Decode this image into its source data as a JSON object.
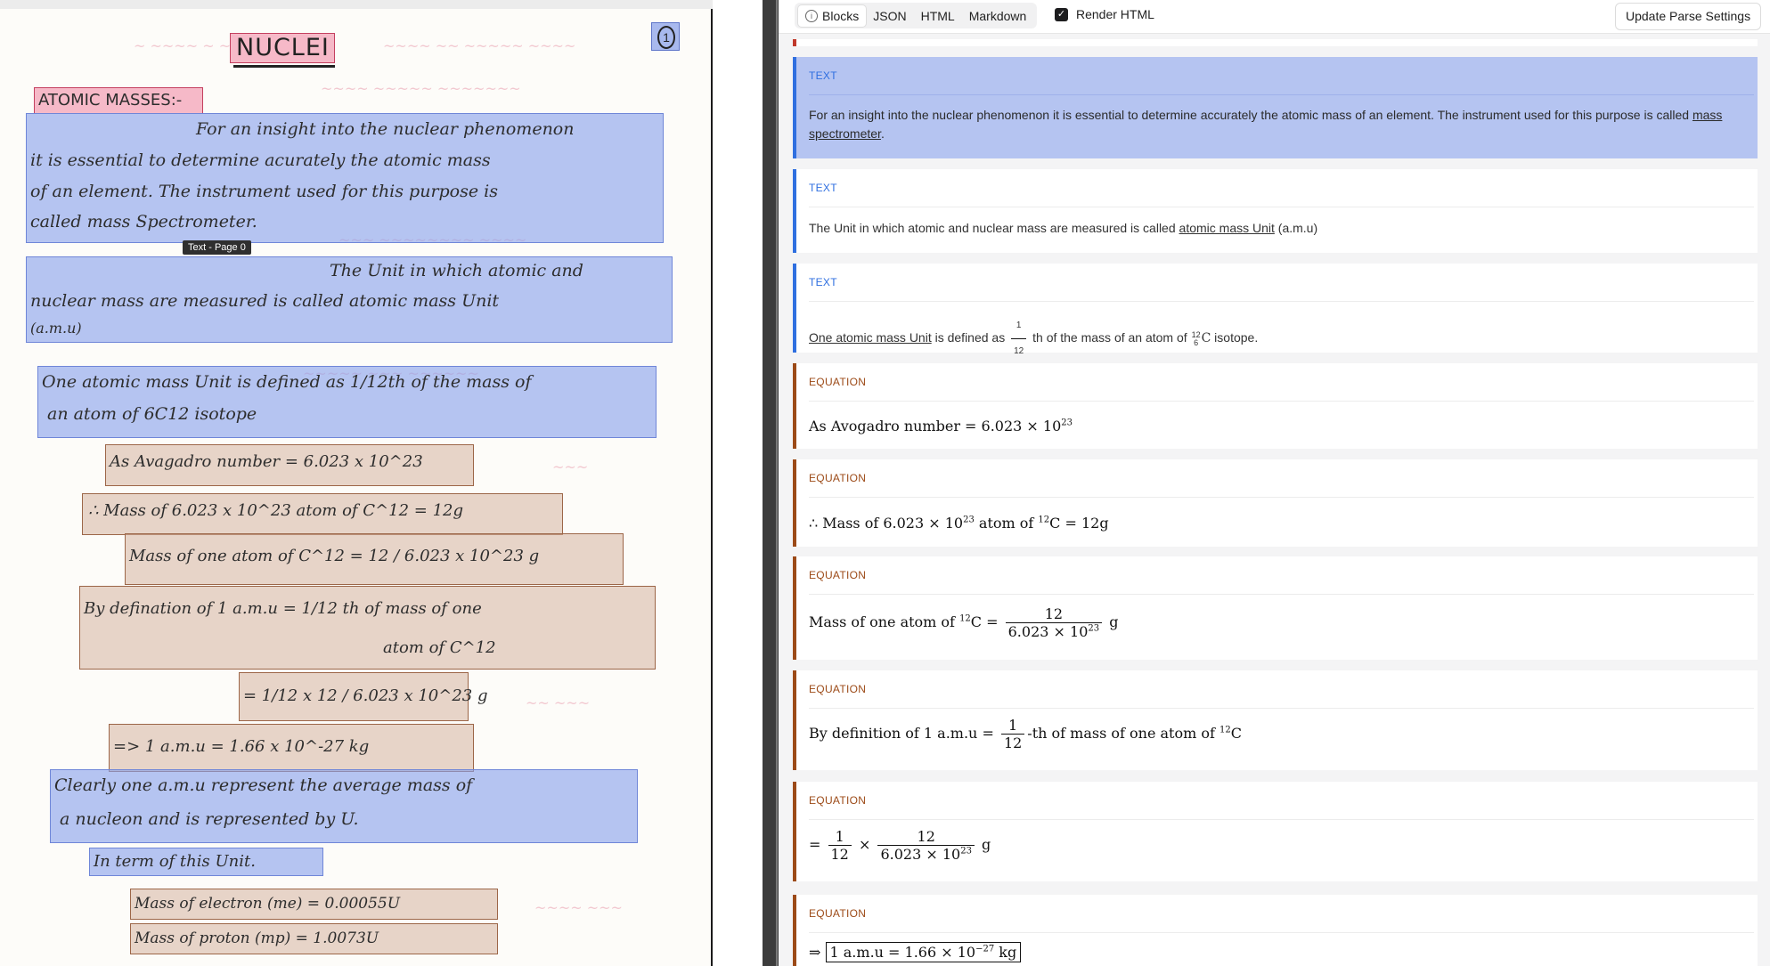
{
  "toolbar": {
    "tabs": [
      "Blocks",
      "JSON",
      "HTML",
      "Markdown"
    ],
    "active_tab": "Blocks",
    "render_html_label": "Render HTML",
    "render_html_checked": true,
    "update_button": "Update Parse Settings"
  },
  "page": {
    "title": "NUCLEI",
    "page_number": "1",
    "tooltip": "Text - Page 0",
    "lines": {
      "atomic_masses": "ATOMIC MASSES:-",
      "t1a": "For an insight into the nuclear phenomenon",
      "t1b": "it is essential to determine acurately the atomic mass",
      "t1c": "of an element. The instrument used for this purpose is",
      "t1d": "called mass Spectrometer.",
      "t2a": "The Unit in which atomic and",
      "t2b": "nuclear mass are measured is called atomic mass Unit",
      "t2c": "(a.m.u)",
      "t3a": "One atomic mass Unit is defined as 1/12th of the mass of",
      "t3b": "an atom of 6C12 isotope",
      "e1": "As Avagadro number = 6.023 x 10^23",
      "e2": "∴ Mass of 6.023 x 10^23 atom of C^12 = 12g",
      "e3": "Mass of one atom of C^12 = 12 / 6.023 x 10^23 g",
      "e4a": "By defination of 1 a.m.u = 1/12 th of mass of one",
      "e4b": "atom of C^12",
      "e5": "= 1/12 x 12 / 6.023 x 10^23 g",
      "e6": "=> 1 a.m.u = 1.66 x 10^-27 kg",
      "t4a": "Clearly one a.m.u represent the average mass of",
      "t4b": "a nucleon and is represented by U.",
      "t5": "In term of this Unit.",
      "e7": "Mass of electron (me) = 0.00055U",
      "e8": "Mass of proton (mp) = 1.0073U"
    }
  },
  "blocks": [
    {
      "type": "TEXT",
      "text_before": "For an insight into the nuclear phenomenon it is essential to determine accurately the atomic mass of an element. The instrument used for this purpose is called ",
      "link": "mass spectrometer",
      "text_after": "."
    },
    {
      "type": "TEXT",
      "text_before": "The Unit in which atomic and nuclear mass are measured is called ",
      "link": "atomic mass Unit",
      "text_after": " (a.m.u)"
    },
    {
      "type": "TEXT",
      "link": "One atomic mass Unit",
      "text_mid": " is defined as ",
      "frac_num": "1",
      "frac_den": "12",
      "text_mid2": " th of the mass of an atom of ",
      "iso_sup": "12",
      "iso_sub": "6",
      "iso_el": "C",
      "text_after": " isotope."
    },
    {
      "type": "EQUATION",
      "a": "As Avogadro number = 6.023 × 10",
      "a_sup": "23"
    },
    {
      "type": "EQUATION",
      "a": "∴ Mass of 6.023 × 10",
      "a_sup": "23",
      "b": " atom of ",
      "b_sup": "12",
      "c": "C = 12g"
    },
    {
      "type": "EQUATION",
      "a": "Mass of one atom of ",
      "a_sup": "12",
      "b": "C =",
      "num": "12",
      "den": "6.023 × 10",
      "den_sup": "23",
      "c": "g"
    },
    {
      "type": "EQUATION",
      "a": "By definition of 1 a.m.u =",
      "num": "1",
      "den": "12",
      "b": "-th of mass of one atom of ",
      "b_sup": "12",
      "c": "C"
    },
    {
      "type": "EQUATION",
      "a": "=",
      "num1": "1",
      "den1": "12",
      "times": "×",
      "num2": "12",
      "den2": "6.023 × 10",
      "den2_sup": "23",
      "c": "g"
    },
    {
      "type": "EQUATION",
      "a": "⇒",
      "boxed": "1 a.m.u = 1.66 × 10",
      "boxed_sup": "−27",
      "boxed_unit": " kg"
    }
  ]
}
